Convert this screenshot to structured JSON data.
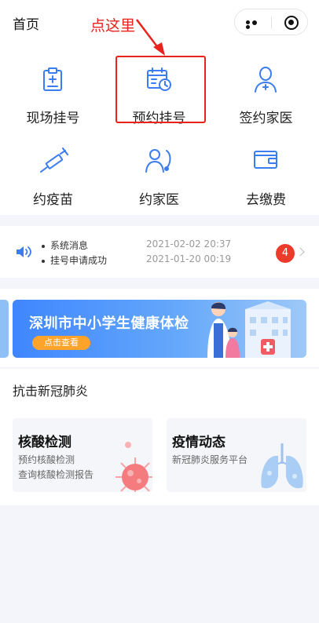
{
  "header": {
    "title": "首页",
    "hint": "点这里"
  },
  "services": [
    {
      "label": "现场挂号",
      "icon": "clipboard-icon"
    },
    {
      "label": "预约挂号",
      "icon": "calendar-clock-icon"
    },
    {
      "label": "签约家医",
      "icon": "doctor-icon"
    },
    {
      "label": "约疫苗",
      "icon": "syringe-icon"
    },
    {
      "label": "约家医",
      "icon": "family-doctor-icon"
    },
    {
      "label": "去缴费",
      "icon": "wallet-icon"
    }
  ],
  "notice": {
    "badge": "4",
    "messages": [
      {
        "text": "系统消息",
        "time": "2021-02-02 20:37"
      },
      {
        "text": "挂号申请成功",
        "time": "2021-01-20 00:19"
      }
    ]
  },
  "banner": {
    "title": "深圳市中小学生健康体检",
    "button": "点击查看"
  },
  "covid": {
    "title": "抗击新冠肺炎",
    "cards": [
      {
        "title": "核酸检测",
        "lines": [
          "预约核酸检测",
          "查询核酸检测报告"
        ],
        "icon": "virus-icon"
      },
      {
        "title": "疫情动态",
        "lines": [
          "新冠肺炎服务平台"
        ],
        "icon": "lungs-icon"
      }
    ]
  },
  "colors": {
    "accent": "#3b7cf0",
    "annotation": "#e8231c",
    "badge": "#ec3a2b",
    "banner_button": "#ffa32b"
  }
}
